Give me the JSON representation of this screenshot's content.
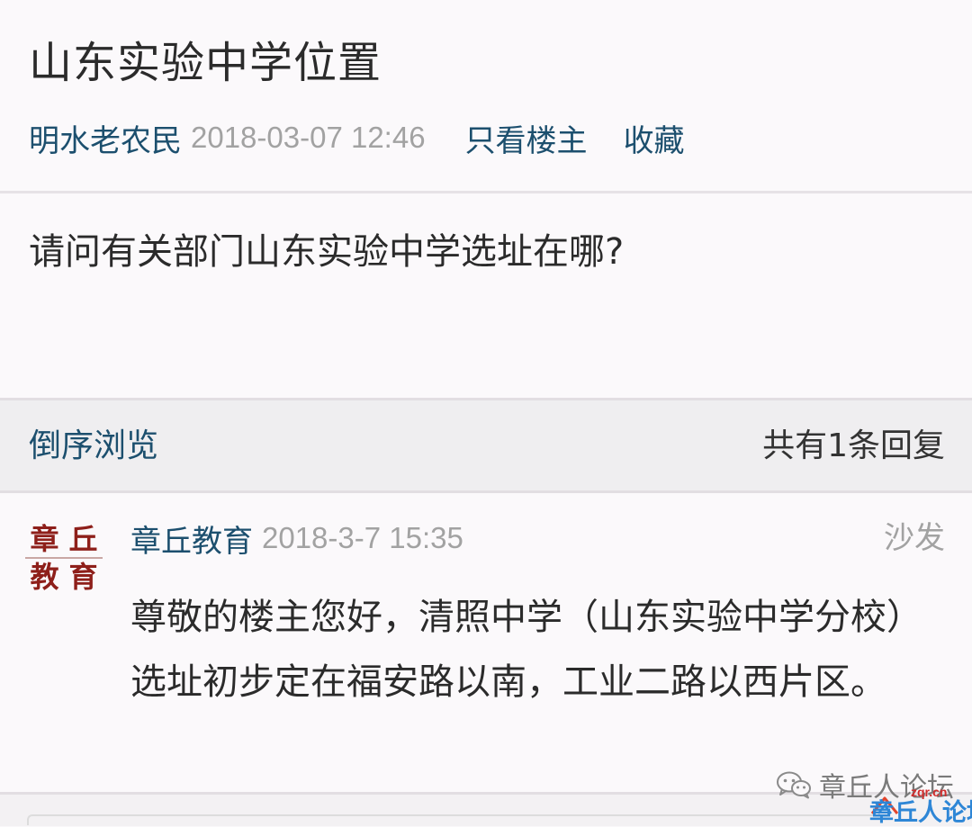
{
  "post": {
    "title": "山东实验中学位置",
    "author": "明水老农民",
    "date": "2018-03-07 12:46",
    "only_op_label": "只看楼主",
    "favorite_label": "收藏",
    "content": "请问有关部门山东实验中学选址在哪?"
  },
  "reply_bar": {
    "sort_label": "倒序浏览",
    "count_text": "共有1条回复"
  },
  "replies": [
    {
      "avatar_chars": [
        "章",
        "丘",
        "教",
        "育"
      ],
      "author": "章丘教育",
      "date": "2018-3-7 15:35",
      "floor": "沙发",
      "content": "尊敬的楼主您好，清照中学（山东实验中学分校）选址初步定在福安路以南，工业二路以西片区。"
    }
  ],
  "watermark": {
    "text": "章丘人论坛",
    "icon": "wechat-icon",
    "logo_domain": "zqr.cn",
    "logo_name": "章丘人论坛"
  },
  "colors": {
    "link": "#1c4f6e",
    "meta_gray": "#a2a2a2",
    "avatar_red": "#8e1f1a",
    "logo_blue": "#2e86d6",
    "logo_red": "#d12b2b"
  }
}
